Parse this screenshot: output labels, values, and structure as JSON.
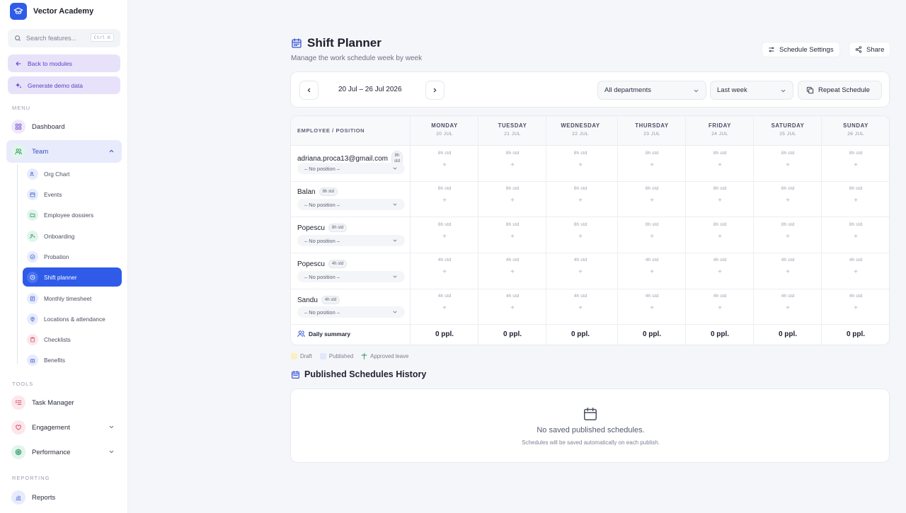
{
  "brand": {
    "name": "Vector Academy",
    "logo_icon": "graduation-cap-icon",
    "accent": "#2f5be8"
  },
  "search": {
    "placeholder": "Search features...",
    "shortcut": "Ctrl K"
  },
  "sidebar_buttons": {
    "back": "Back to modules",
    "demo": "Generate demo data"
  },
  "sections": {
    "menu": "MENU",
    "tools": "TOOLS",
    "reporting": "REPORTING"
  },
  "menu": {
    "dashboard": "Dashboard",
    "team": "Team",
    "team_children": [
      "Org Chart",
      "Events",
      "Employee dossiers",
      "Onboarding",
      "Probation",
      "Shift planner",
      "Monthly timesheet",
      "Locations & attendance",
      "Checklists",
      "Benefits"
    ]
  },
  "tools": {
    "task_manager": "Task Manager",
    "engagement": "Engagement",
    "performance": "Performance"
  },
  "reporting": {
    "reports": "Reports"
  },
  "page": {
    "title": "Shift Planner",
    "subtitle": "Manage the work schedule week by week",
    "schedule_settings": "Schedule Settings",
    "share": "Share"
  },
  "toolbar": {
    "week_range": "20 Jul – 26 Jul 2026",
    "department": "All departments",
    "period": "Last week",
    "repeat": "Repeat Schedule"
  },
  "grid": {
    "employee_header": "EMPLOYEE / POSITION",
    "days": [
      {
        "name": "MONDAY",
        "date": "20 JUL"
      },
      {
        "name": "TUESDAY",
        "date": "21 JUL"
      },
      {
        "name": "WEDNESDAY",
        "date": "22 JUL"
      },
      {
        "name": "THURSDAY",
        "date": "23 JUL"
      },
      {
        "name": "FRIDAY",
        "date": "24 JUL"
      },
      {
        "name": "SATURDAY",
        "date": "25 JUL"
      },
      {
        "name": "SUNDAY",
        "date": "26 JUL"
      }
    ],
    "rows": [
      {
        "name": "adriana.proca13@gmail.com",
        "badge": "8h std",
        "position": "– No position –",
        "std": "8h std"
      },
      {
        "name": "Balan",
        "badge": "8h std",
        "position": "– No position –",
        "std": "8h std"
      },
      {
        "name": "Popescu",
        "badge": "8h std",
        "position": "– No position –",
        "std": "8h std"
      },
      {
        "name": "Popescu",
        "badge": "4h std",
        "position": "– No position –",
        "std": "4h std"
      },
      {
        "name": "Sandu",
        "badge": "4h std",
        "position": "– No position –",
        "std": "4h std"
      }
    ],
    "add_symbol": "+",
    "summary_label": "Daily summary",
    "summary_values": [
      "0 ppl.",
      "0 ppl.",
      "0 ppl.",
      "0 ppl.",
      "0 ppl.",
      "0 ppl.",
      "0 ppl."
    ]
  },
  "legend": [
    {
      "label": "Draft",
      "color": "#fcefc2"
    },
    {
      "label": "Published",
      "color": "#e3e7fb"
    },
    {
      "label": "Approved leave",
      "color": "#2e9a6b"
    }
  ],
  "history": {
    "title": "Published Schedules History",
    "empty": "No saved published schedules.",
    "note": "Schedules will be saved automatically on each publish."
  }
}
